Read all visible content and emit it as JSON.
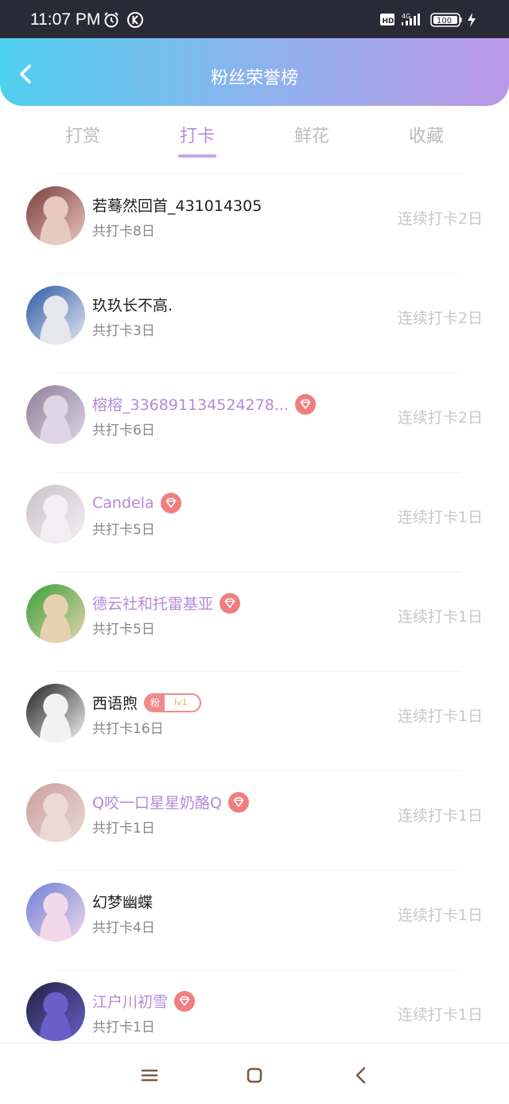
{
  "status_bar": {
    "time": "11:07 PM",
    "hd": "HD",
    "network": "4G",
    "battery": "100"
  },
  "header": {
    "title": "粉丝荣誉榜"
  },
  "tabs": [
    "打赏",
    "打卡",
    "鲜花",
    "收藏"
  ],
  "active_tab": "打卡",
  "fans": [
    {
      "name": "若蓦然回首_431014305",
      "total": "共打卡8日",
      "streak": "连续打卡2日",
      "badge": "none",
      "purple": false,
      "avatar_colors": [
        "#7a3b3b",
        "#e8c9c0"
      ]
    },
    {
      "name": "玖玖长不高.",
      "total": "共打卡3日",
      "streak": "连续打卡2日",
      "badge": "none",
      "purple": false,
      "avatar_colors": [
        "#2a5aa8",
        "#e6e6ef"
      ]
    },
    {
      "name": "榕榕_336891134524278...",
      "total": "共打卡6日",
      "streak": "连续打卡2日",
      "badge": "gem",
      "purple": true,
      "avatar_colors": [
        "#8e8099",
        "#ded4e4"
      ]
    },
    {
      "name": "Candela",
      "total": "共打卡5日",
      "streak": "连续打卡1日",
      "badge": "gem",
      "purple": true,
      "avatar_colors": [
        "#c9c2c8",
        "#f4eef2"
      ]
    },
    {
      "name": "德云社和托雷基亚",
      "total": "共打卡5日",
      "streak": "连续打卡1日",
      "badge": "gem",
      "purple": true,
      "avatar_colors": [
        "#3aa236",
        "#e6d2b0"
      ]
    },
    {
      "name": "西语煦",
      "total": "共打卡16日",
      "streak": "连续打卡1日",
      "badge": "fan",
      "fan_label": "粉",
      "fan_level": "lv1",
      "purple": false,
      "avatar_colors": [
        "#222222",
        "#f2f2f2"
      ]
    },
    {
      "name": "Q咬一口星星奶酪Q",
      "total": "共打卡1日",
      "streak": "连续打卡1日",
      "badge": "gem",
      "purple": true,
      "avatar_colors": [
        "#c99f9c",
        "#ecd9d3"
      ]
    },
    {
      "name": "幻梦幽蝶",
      "total": "共打卡4日",
      "streak": "连续打卡1日",
      "badge": "none",
      "purple": false,
      "avatar_colors": [
        "#6f7fd8",
        "#f1d8ea"
      ]
    },
    {
      "name": "江户川初雪",
      "total": "共打卡1日",
      "streak": "连续打卡1日",
      "badge": "gem",
      "purple": true,
      "avatar_colors": [
        "#1e2240",
        "#6a5fc8"
      ]
    }
  ],
  "colors": {
    "header_gradient_start": "#4fd0ef",
    "header_gradient_end": "#bb97e8",
    "accent_purple": "#b48ad8",
    "badge_red": "#ef8a8a"
  },
  "nav_icons": [
    "menu-icon",
    "home-square-icon",
    "back-chevron-icon"
  ]
}
